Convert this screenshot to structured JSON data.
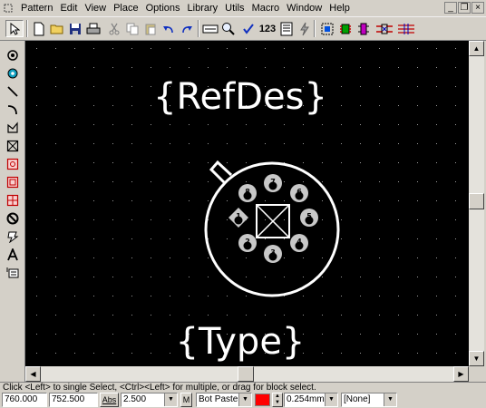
{
  "menu": [
    "Pattern",
    "Edit",
    "View",
    "Place",
    "Options",
    "Library",
    "Utils",
    "Macro",
    "Window",
    "Help"
  ],
  "toolbar": {
    "count_label": "123"
  },
  "canvas": {
    "refdes_text": "{RefDes}",
    "type_text": "{Type}",
    "pins": [
      {
        "label": "1"
      },
      {
        "label": "2"
      },
      {
        "label": "3"
      },
      {
        "label": "4"
      },
      {
        "label": "5"
      },
      {
        "label": "6"
      },
      {
        "label": "7"
      },
      {
        "label": "8"
      }
    ]
  },
  "status": {
    "message": "Click <Left> to single Select, <Ctrl><Left> for multiple, or drag for block select."
  },
  "bottom": {
    "x_coord": "760.000",
    "y_coord": "752.500",
    "abs_label": "Abs",
    "grid": "2.500",
    "m_label": "M",
    "layer": "Bot Paste",
    "layer_color": "#ff0000",
    "line_width": "0.254mm",
    "net": "[None]"
  }
}
